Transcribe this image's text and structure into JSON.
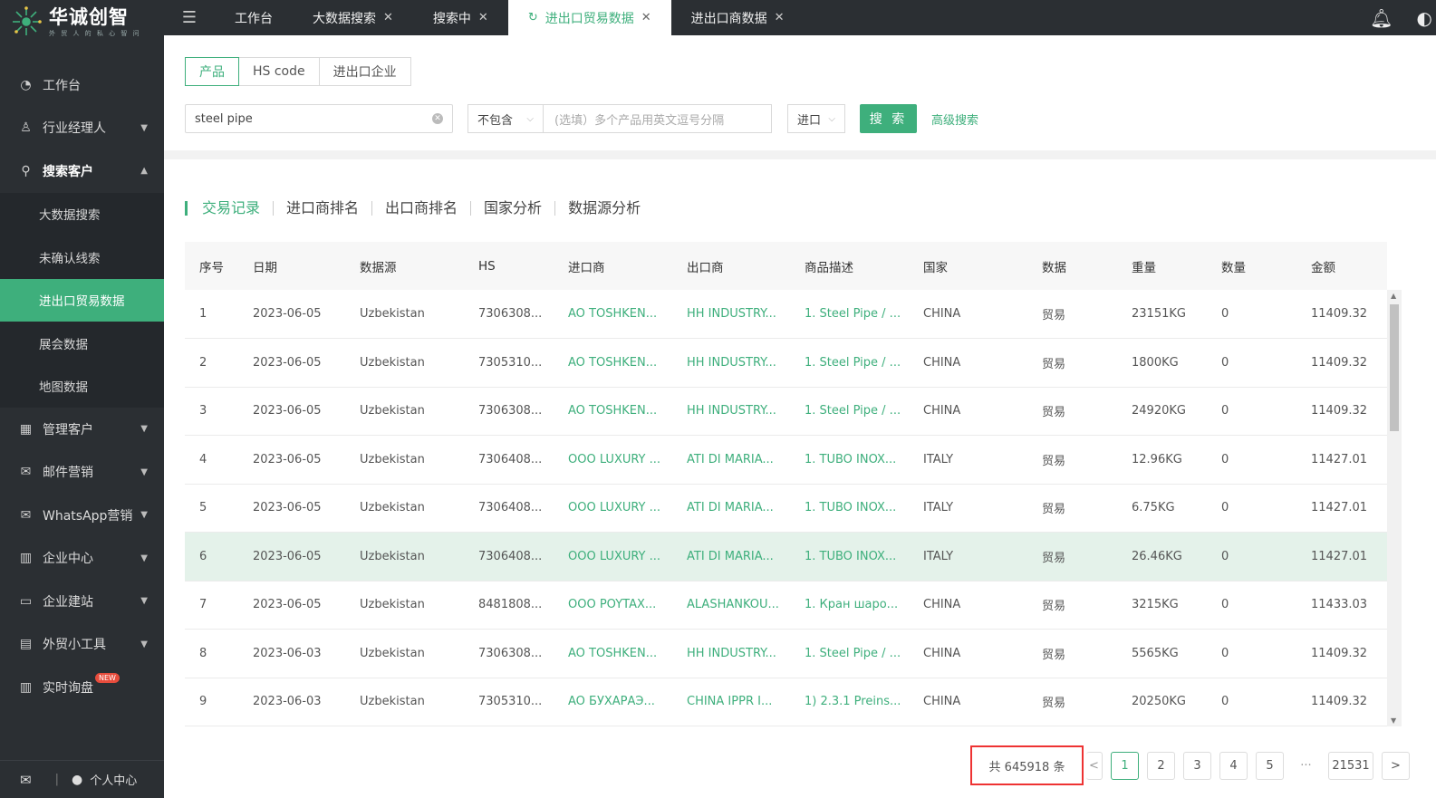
{
  "brand": {
    "title": "华诚创智",
    "subtitle": "外 贸 人 的 私 心 智 问"
  },
  "sidebar": {
    "items": [
      {
        "label": "工作台",
        "icon": "dashboard-icon"
      },
      {
        "label": "行业经理人",
        "icon": "user-icon",
        "chevron": "⌄"
      },
      {
        "label": "搜索客户",
        "icon": "search-icon",
        "chevron": "⌃",
        "open": true,
        "children": [
          "大数据搜索",
          "未确认线索",
          "进出口贸易数据",
          "展会数据",
          "地图数据"
        ],
        "active_child": "进出口贸易数据"
      },
      {
        "label": "管理客户",
        "icon": "grid-icon",
        "chevron": "⌄"
      },
      {
        "label": "邮件营销",
        "icon": "mail-icon",
        "chevron": "⌄"
      },
      {
        "label": "WhatsApp营销",
        "icon": "mail-icon",
        "chevron": "⌄"
      },
      {
        "label": "企业中心",
        "icon": "building-icon",
        "chevron": "⌄"
      },
      {
        "label": "企业建站",
        "icon": "monitor-icon",
        "chevron": "⌄"
      },
      {
        "label": "外贸小工具",
        "icon": "briefcase-icon",
        "chevron": "⌄"
      },
      {
        "label": "实时询盘",
        "icon": "building-icon",
        "badge": "NEW"
      }
    ],
    "footer": {
      "user_label": "个人中心"
    }
  },
  "topbar": {
    "tabs": [
      {
        "label": "工作台",
        "closable": false
      },
      {
        "label": "大数据搜索",
        "closable": true
      },
      {
        "label": "搜索中",
        "closable": true
      },
      {
        "label": "进出口贸易数据",
        "closable": true,
        "active": true
      },
      {
        "label": "进出口商数据",
        "closable": true
      }
    ]
  },
  "search": {
    "segments": [
      "产品",
      "HS code",
      "进出口企业"
    ],
    "active_segment": "产品",
    "keyword": "steel pipe",
    "exclude_mode": "不包含",
    "exclude_placeholder": "(选填）多个产品用英文逗号分隔",
    "direction": "进口",
    "search_label": "搜 索",
    "advanced_label": "高级搜索"
  },
  "subtabs": [
    "交易记录",
    "进口商排名",
    "出口商排名",
    "国家分析",
    "数据源分析"
  ],
  "table": {
    "columns": [
      "序号",
      "日期",
      "数据源",
      "HS",
      "进口商",
      "出口商",
      "商品描述",
      "国家",
      "数据",
      "重量",
      "数量",
      "金额"
    ],
    "rows": [
      [
        "1",
        "2023-06-05",
        "Uzbekistan",
        "7306308...",
        "AO TOSHKEN...",
        "HH INDUSTRY...",
        "1. Steel Pipe / ...",
        "CHINA",
        "贸易",
        "23151KG",
        "0",
        "11409.32"
      ],
      [
        "2",
        "2023-06-05",
        "Uzbekistan",
        "7305310...",
        "AO TOSHKEN...",
        "HH INDUSTRY...",
        "1. Steel Pipe / ...",
        "CHINA",
        "贸易",
        "1800KG",
        "0",
        "11409.32"
      ],
      [
        "3",
        "2023-06-05",
        "Uzbekistan",
        "7306308...",
        "AO TOSHKEN...",
        "HH INDUSTRY...",
        "1. Steel Pipe / ...",
        "CHINA",
        "贸易",
        "24920KG",
        "0",
        "11409.32"
      ],
      [
        "4",
        "2023-06-05",
        "Uzbekistan",
        "7306408...",
        "OOO LUXURY ...",
        "ATI DI MARIA...",
        "1. TUBO INOX...",
        "ITALY",
        "贸易",
        "12.96KG",
        "0",
        "11427.01"
      ],
      [
        "5",
        "2023-06-05",
        "Uzbekistan",
        "7306408...",
        "OOO LUXURY ...",
        "ATI DI MARIA...",
        "1. TUBO INOX...",
        "ITALY",
        "贸易",
        "6.75KG",
        "0",
        "11427.01"
      ],
      [
        "6",
        "2023-06-05",
        "Uzbekistan",
        "7306408...",
        "OOO LUXURY ...",
        "ATI DI MARIA...",
        "1. TUBO INOX...",
        "ITALY",
        "贸易",
        "26.46KG",
        "0",
        "11427.01"
      ],
      [
        "7",
        "2023-06-05",
        "Uzbekistan",
        "8481808...",
        "OOO POYTAX...",
        "ALASHANKOU...",
        "1. Кран шаро...",
        "CHINA",
        "贸易",
        "3215KG",
        "0",
        "11433.03"
      ],
      [
        "8",
        "2023-06-03",
        "Uzbekistan",
        "7306308...",
        "AO TOSHKEN...",
        "HH INDUSTRY...",
        "1. Steel Pipe / ...",
        "CHINA",
        "贸易",
        "5565KG",
        "0",
        "11409.32"
      ],
      [
        "9",
        "2023-06-03",
        "Uzbekistan",
        "7305310...",
        "AO БУХАРАЭ...",
        "CHINA IPPR I...",
        "1) 2.3.1 Preins...",
        "CHINA",
        "贸易",
        "20250KG",
        "0",
        "11409.32"
      ]
    ],
    "highlighted_row": 6
  },
  "pager": {
    "total": "共 645918 条",
    "pages": [
      "1",
      "2",
      "3",
      "4",
      "5"
    ],
    "ellipsis": "···",
    "last": "21531",
    "prev": "<",
    "next": ">"
  },
  "colors": {
    "accent": "#3eaf7c",
    "sidebar": "#2b2f33",
    "highlight_box": "#e33333"
  }
}
